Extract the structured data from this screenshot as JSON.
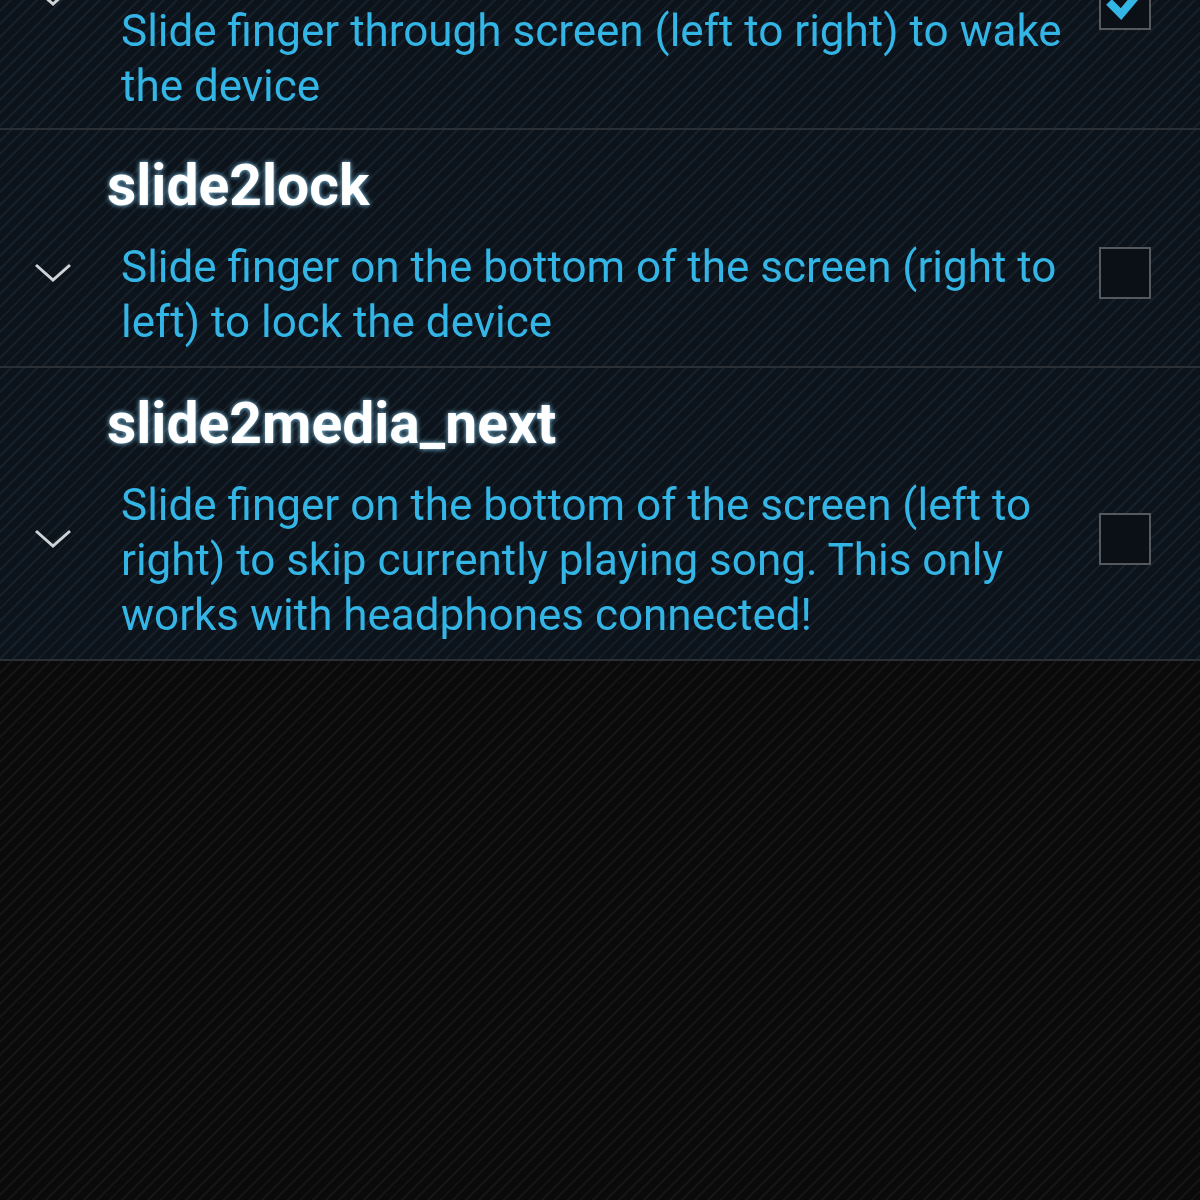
{
  "settings": [
    {
      "description": "Slide finger through screen (left to right) to wake the device",
      "checked": true,
      "expanded": false
    },
    {
      "title": "slide2lock",
      "description": "Slide finger on the bottom of the screen (right to left) to lock the device",
      "checked": false,
      "expanded": false
    },
    {
      "title": "slide2media_next",
      "description": "Slide finger on the bottom of the screen (left to right) to skip currently playing song. This only works with headphones connected!",
      "checked": false,
      "expanded": false
    }
  ]
}
